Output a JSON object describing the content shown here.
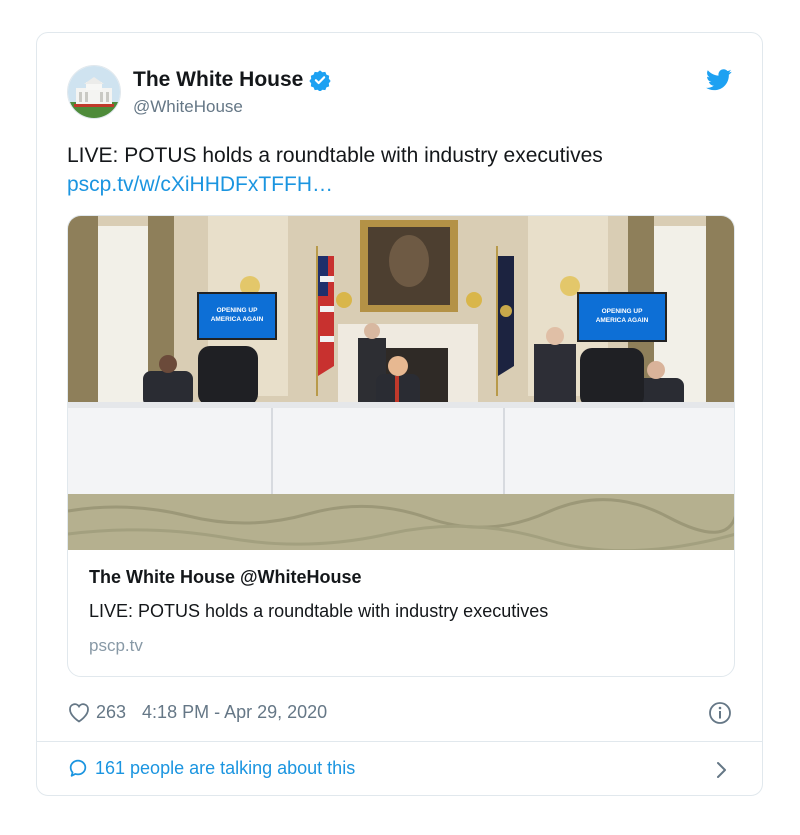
{
  "author": {
    "name": "The White House",
    "handle": "@WhiteHouse"
  },
  "tweet": {
    "text": "LIVE: POTUS holds a roundtable with industry executives",
    "link": "pscp.tv/w/cXiHHDFxTFFH…"
  },
  "screens": {
    "caption_line1": "OPENING UP",
    "caption_line2": "AMERICA AGAIN"
  },
  "link_card": {
    "title": "The White House @WhiteHouse",
    "description": "LIVE: POTUS holds a roundtable with industry executives",
    "domain": "pscp.tv"
  },
  "meta": {
    "likes": "263",
    "timestamp": "4:18 PM - Apr 29, 2020"
  },
  "footer": {
    "talking": "161 people are talking about this"
  },
  "icons": [
    "verified-badge-icon",
    "twitter-bird-icon",
    "heart-icon",
    "info-icon",
    "comment-bubble-icon",
    "chevron-right-icon"
  ],
  "colors": {
    "brand": "#1da1f2",
    "link": "#1b95e0",
    "muted": "#657786",
    "border": "#e1e8ed"
  }
}
